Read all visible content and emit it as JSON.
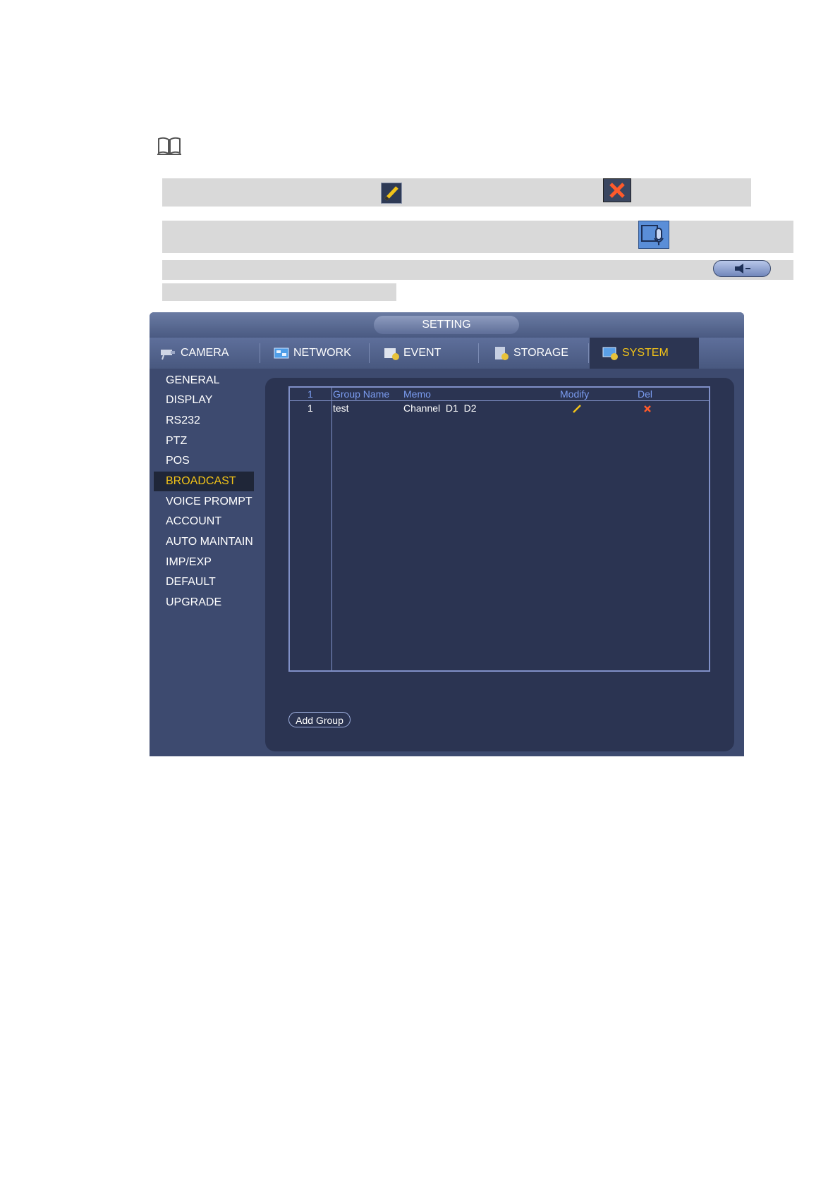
{
  "window": {
    "title": "SETTING"
  },
  "tabs": [
    {
      "label": "CAMERA",
      "icon": "camera-icon"
    },
    {
      "label": "NETWORK",
      "icon": "network-icon"
    },
    {
      "label": "EVENT",
      "icon": "event-icon"
    },
    {
      "label": "STORAGE",
      "icon": "storage-icon"
    },
    {
      "label": "SYSTEM",
      "icon": "system-icon",
      "active": true
    }
  ],
  "sidebar": {
    "items": [
      {
        "label": "GENERAL"
      },
      {
        "label": "DISPLAY"
      },
      {
        "label": "RS232"
      },
      {
        "label": "PTZ"
      },
      {
        "label": "POS"
      },
      {
        "label": "BROADCAST",
        "active": true
      },
      {
        "label": "VOICE PROMPT"
      },
      {
        "label": "ACCOUNT"
      },
      {
        "label": "AUTO MAINTAIN"
      },
      {
        "label": "IMP/EXP"
      },
      {
        "label": "DEFAULT"
      },
      {
        "label": "UPGRADE"
      }
    ]
  },
  "table": {
    "headers": {
      "num": "1",
      "group_name": "Group Name",
      "memo": "Memo",
      "modify": "Modify",
      "del": "Del"
    },
    "rows": [
      {
        "num": "1",
        "group_name": "test",
        "memo": "Channel  D1  D2"
      }
    ]
  },
  "buttons": {
    "add_group": "Add Group"
  },
  "colors": {
    "accent": "#f2c318",
    "header_text": "#7b9cf0",
    "background": "#3d4a6f",
    "panel": "#2b3452"
  }
}
